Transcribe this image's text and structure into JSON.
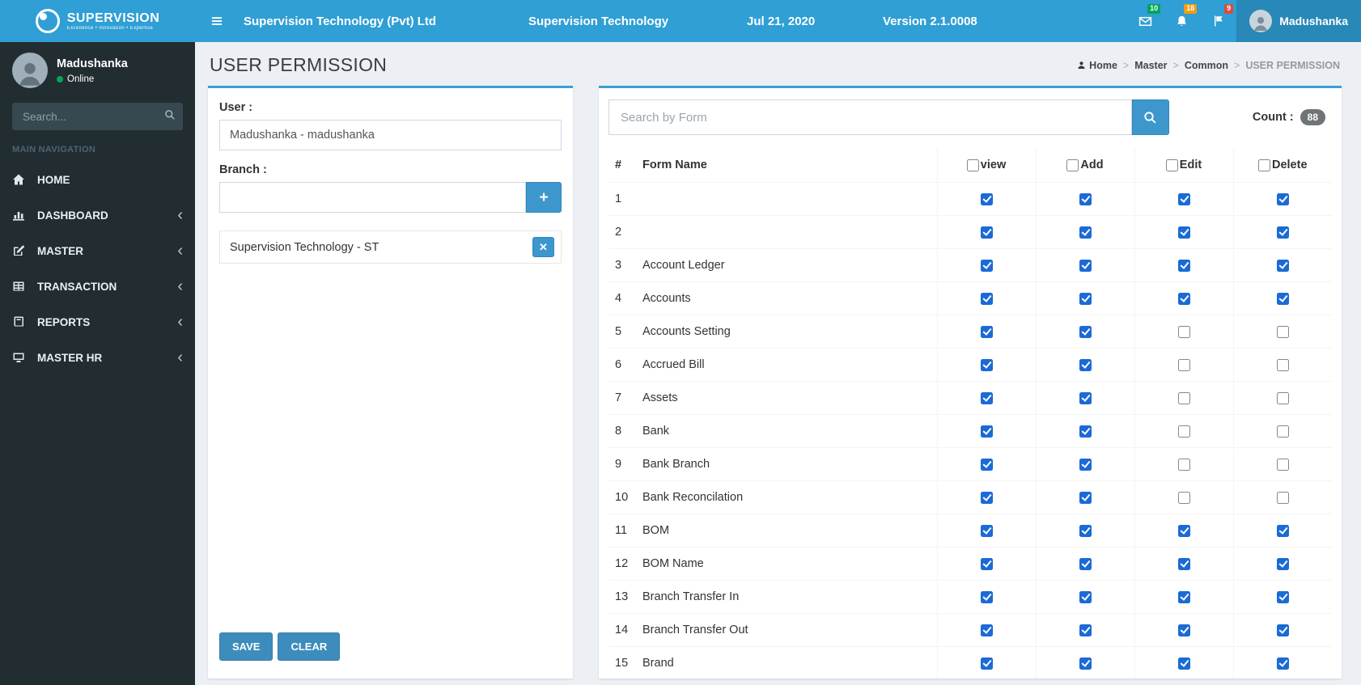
{
  "topbar": {
    "logo_title": "SUPERVISION",
    "logo_tagline": "Excellence • Innovation • Expertise",
    "company": "Supervision Technology (Pvt) Ltd",
    "app_name": "Supervision Technology",
    "date": "Jul 21, 2020",
    "version": "Version 2.1.0008",
    "badges": {
      "messages": "10",
      "notifications": "18",
      "flags": "9"
    },
    "user_name": "Madushanka"
  },
  "sidebar": {
    "user": {
      "name": "Madushanka",
      "status": "Online"
    },
    "search_placeholder": "Search...",
    "nav_label": "MAIN NAVIGATION",
    "items": [
      {
        "label": "HOME",
        "icon": "home-icon",
        "expandable": false
      },
      {
        "label": "DASHBOARD",
        "icon": "dashboard-icon",
        "expandable": true
      },
      {
        "label": "MASTER",
        "icon": "master-icon",
        "expandable": true
      },
      {
        "label": "TRANSACTION",
        "icon": "transaction-icon",
        "expandable": true
      },
      {
        "label": "REPORTS",
        "icon": "reports-icon",
        "expandable": true
      },
      {
        "label": "MASTER HR",
        "icon": "master-hr-icon",
        "expandable": true
      }
    ]
  },
  "page": {
    "title": "USER PERMISSION",
    "breadcrumb": [
      "Home",
      "Master",
      "Common",
      "USER PERMISSION"
    ]
  },
  "left_panel": {
    "user_label": "User :",
    "user_value": "Madushanka - madushanka",
    "branch_label": "Branch :",
    "branch_value": "",
    "selected_branch": "Supervision Technology - ST",
    "save_label": "SAVE",
    "clear_label": "CLEAR"
  },
  "right_panel": {
    "search_placeholder": "Search by Form",
    "count_label": "Count :",
    "count_value": "88",
    "table": {
      "headers": [
        "#",
        "Form Name",
        "view",
        "Add",
        "Edit",
        "Delete"
      ],
      "header_checkboxes": {
        "view": false,
        "add": false,
        "edit": false,
        "delete": false
      },
      "rows": [
        {
          "no": "1",
          "name": "",
          "view": true,
          "add": true,
          "edit": true,
          "delete": true
        },
        {
          "no": "2",
          "name": "",
          "view": true,
          "add": true,
          "edit": true,
          "delete": true
        },
        {
          "no": "3",
          "name": "Account Ledger",
          "view": true,
          "add": true,
          "edit": true,
          "delete": true
        },
        {
          "no": "4",
          "name": "Accounts",
          "view": true,
          "add": true,
          "edit": true,
          "delete": true
        },
        {
          "no": "5",
          "name": "Accounts Setting",
          "view": true,
          "add": true,
          "edit": false,
          "delete": false
        },
        {
          "no": "6",
          "name": "Accrued Bill",
          "view": true,
          "add": true,
          "edit": false,
          "delete": false
        },
        {
          "no": "7",
          "name": "Assets",
          "view": true,
          "add": true,
          "edit": false,
          "delete": false
        },
        {
          "no": "8",
          "name": "Bank",
          "view": true,
          "add": true,
          "edit": false,
          "delete": false
        },
        {
          "no": "9",
          "name": "Bank Branch",
          "view": true,
          "add": true,
          "edit": false,
          "delete": false
        },
        {
          "no": "10",
          "name": "Bank Reconcilation",
          "view": true,
          "add": true,
          "edit": false,
          "delete": false
        },
        {
          "no": "11",
          "name": "BOM",
          "view": true,
          "add": true,
          "edit": true,
          "delete": true
        },
        {
          "no": "12",
          "name": "BOM Name",
          "view": true,
          "add": true,
          "edit": true,
          "delete": true
        },
        {
          "no": "13",
          "name": "Branch Transfer In",
          "view": true,
          "add": true,
          "edit": true,
          "delete": true
        },
        {
          "no": "14",
          "name": "Branch Transfer Out",
          "view": true,
          "add": true,
          "edit": true,
          "delete": true
        },
        {
          "no": "15",
          "name": "Brand",
          "view": true,
          "add": true,
          "edit": true,
          "delete": true
        }
      ]
    }
  },
  "icons": {
    "plus": "+",
    "close": "✕",
    "chevron": "‹"
  },
  "colors": {
    "topbar": "#2f9fd5",
    "sidebar": "#222d32",
    "panel_accent": "#3c9fd6",
    "button_primary": "#3c8dbc",
    "button_light_blue": "#3d97cd",
    "checkbox_checked": "#1b6ad6",
    "badge_green": "#00a65a",
    "badge_orange": "#f39c12",
    "badge_red": "#dd4b39",
    "count_badge": "#6e7478",
    "status_online": "#00a65a",
    "background": "#ecf0f5"
  }
}
